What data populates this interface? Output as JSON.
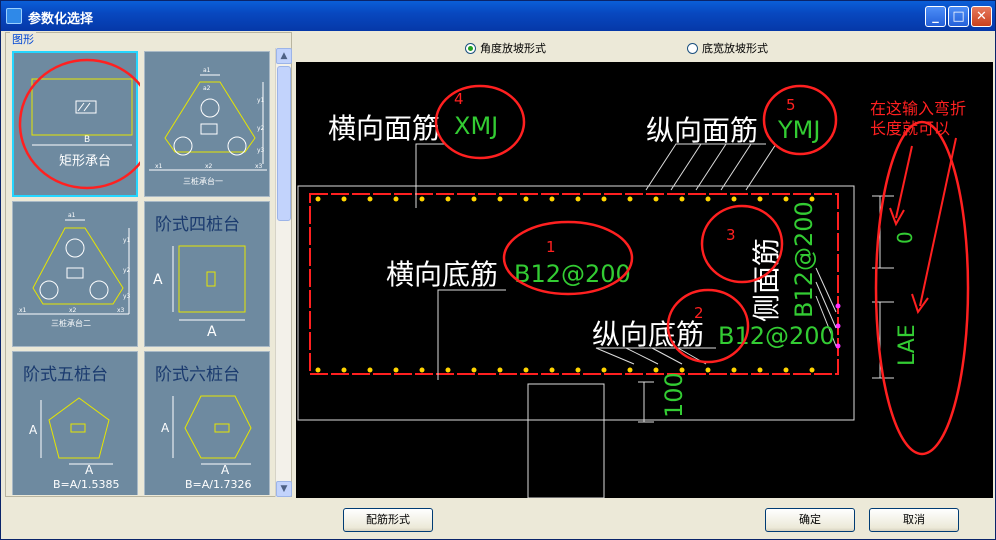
{
  "window": {
    "title": "参数化选择",
    "buttons": {
      "minimize": "_",
      "maximize": "□",
      "close": "✕"
    }
  },
  "left_panel": {
    "group_label": "图形",
    "thumbnails": [
      {
        "label": "矩形承台",
        "dim": "B"
      },
      {
        "label": "三桩承台一",
        "dims": [
          "a1",
          "a2",
          "y1",
          "y2",
          "y3",
          "x1",
          "x2",
          "x3"
        ]
      },
      {
        "label": "三桩承台二",
        "dims": [
          "a1",
          "y1",
          "y2",
          "y3",
          "x1",
          "x2",
          "x3"
        ]
      },
      {
        "label": "阶式四桩台",
        "dims": [
          "A",
          "A"
        ]
      },
      {
        "label": "阶式五桩台",
        "dims": [
          "A",
          "A"
        ],
        "note": "B=A/1.5385"
      },
      {
        "label": "阶式六桩台",
        "dims": [
          "A",
          "A"
        ],
        "note": "B=A/1.7326"
      }
    ]
  },
  "options": {
    "radio1": "角度放坡形式",
    "radio2": "底宽放坡形式"
  },
  "drawing": {
    "top_transverse_label": "横向面筋",
    "top_transverse_value": "XMJ",
    "top_longitudinal_label": "纵向面筋",
    "top_longitudinal_value": "YMJ",
    "bottom_transverse_label": "横向底筋",
    "bottom_transverse_value": "B12@200",
    "bottom_longitudinal_label": "纵向底筋",
    "bottom_longitudinal_value": "B12@200",
    "side_label": "侧面筋",
    "side_value": "B12@200",
    "cover": "100",
    "bend_top": "0",
    "bend_bottom": "LAE",
    "annotation": [
      "在这输入弯折",
      "长度就可以"
    ],
    "markers": [
      "1",
      "2",
      "3",
      "4",
      "5"
    ]
  },
  "footer": {
    "rebar_button": "配筋形式",
    "ok_button": "确定",
    "cancel_button": "取消"
  },
  "colors": {
    "title_bar": "#0848c0",
    "canvas": "#000000",
    "thumb_bg": "#6e8aa0",
    "dim_green": "#33cc33",
    "marker_red": "#ff2020",
    "shape_yellow": "#e6e600"
  }
}
